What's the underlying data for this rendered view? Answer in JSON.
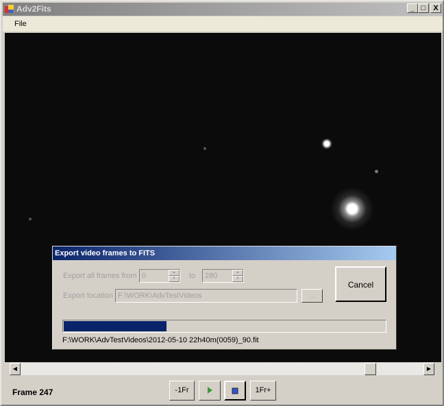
{
  "window": {
    "title": "Adv2Fits",
    "minimize": "_",
    "maximize": "□",
    "close": "X"
  },
  "menu": {
    "file": "File"
  },
  "dialog": {
    "title": "Export video frames to FITS",
    "from_label": "Export all frames from",
    "from_value": "0",
    "to_label": "to",
    "to_value": "280",
    "location_label": "Export location",
    "location_value": "F:\\WORK\\AdvTestVideos",
    "browse_label": "...",
    "cancel_label": "Cancel",
    "progress_percent": 32,
    "current_file": "F:\\WORK\\AdvTestVideos\\2012-05-10 22h40m(0059)_90.fit"
  },
  "playback": {
    "frame_label": "Frame 247",
    "slider_fraction": 0.88,
    "prev_label": "-1Fr",
    "next_label": "1Fr+",
    "colors": {
      "progress": "#0a246a",
      "play": "#3a9a3a",
      "stop": "#3355cc"
    }
  }
}
